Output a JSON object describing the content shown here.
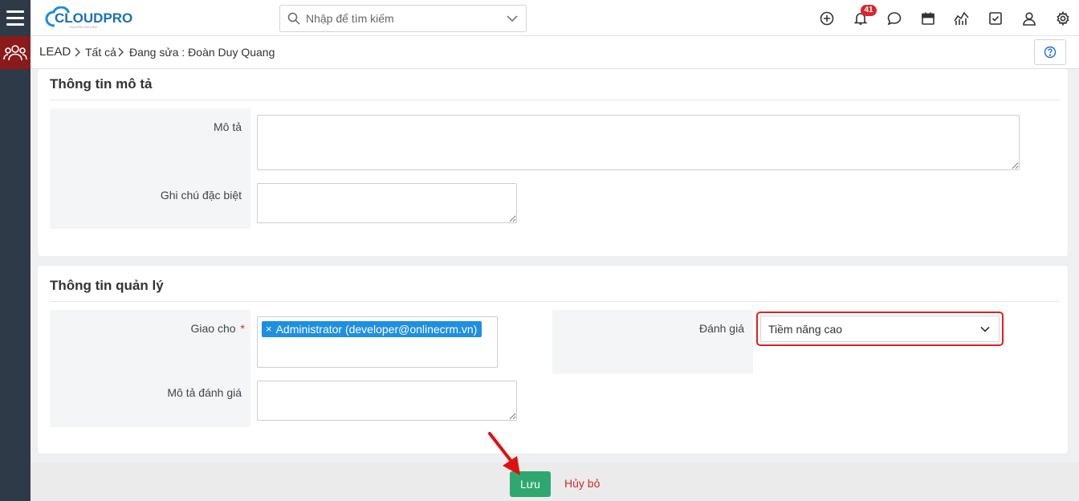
{
  "app": {
    "logo_text": "CLOUDPRO",
    "logo_tagline": "CHUYÊN GIA CRM"
  },
  "search": {
    "placeholder": "Nhập để tìm kiếm"
  },
  "header": {
    "notification_count": "41"
  },
  "breadcrumb": {
    "module": "LEAD",
    "list": "Tất cả",
    "current": "Đang sửa : Đoàn Duy Quang"
  },
  "description_section": {
    "title": "Thông tin mô tả",
    "description_label": "Mô tả",
    "description_value": "",
    "special_note_label": "Ghi chú đặc biệt",
    "special_note_value": ""
  },
  "management_section": {
    "title": "Thông tin quản lý",
    "assigned_label": "Giao cho",
    "required_mark": "*",
    "assigned_tag": "Administrator (developer@onlinecrm.vn)",
    "tag_remove": "×",
    "rating_label": "Đánh giá",
    "rating_value": "Tiềm năng cao",
    "rating_desc_label": "Mô tả đánh giá",
    "rating_desc_value": ""
  },
  "footer": {
    "save_label": "Lưu",
    "cancel_label": "Hủy bỏ"
  },
  "colors": {
    "accent_green": "#2fa870",
    "danger_red": "#d9262c",
    "tag_blue": "#1f8fe0",
    "rail_dark": "#2f3a48",
    "module_red": "#8b1a1a"
  }
}
